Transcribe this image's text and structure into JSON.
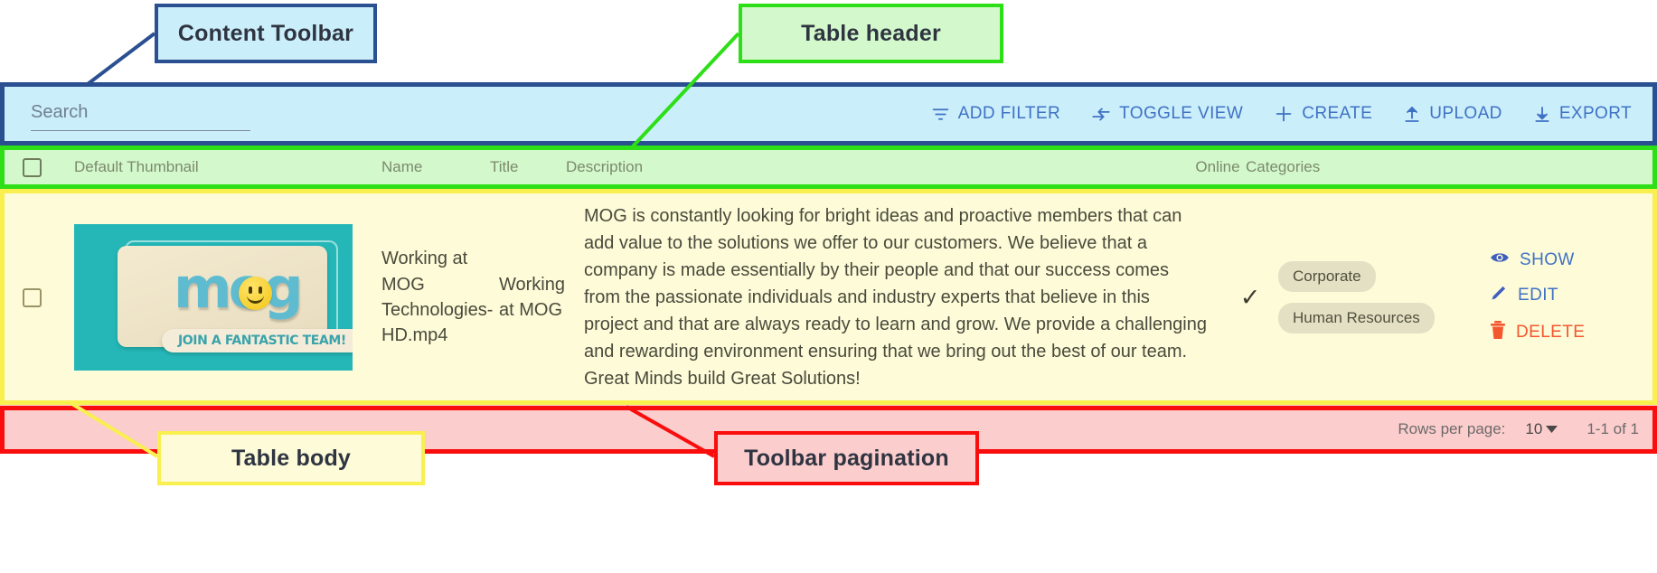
{
  "annotations": [
    {
      "id": "content-toolbar",
      "label": "Content Toolbar",
      "color": "#2b5091",
      "fill": "#cbeefb"
    },
    {
      "id": "table-header",
      "label": "Table header",
      "color": "#2ddf16",
      "fill": "#d3f8cc"
    },
    {
      "id": "table-body",
      "label": "Table body",
      "color": "#f9ef4f",
      "fill": "#fdfbd8"
    },
    {
      "id": "toolbar-pagination",
      "label": "Toolbar pagination",
      "color": "#f90d0d",
      "fill": "#fbcdcd"
    }
  ],
  "toolbar": {
    "search": {
      "value": "",
      "placeholder": "Search"
    },
    "actions": [
      {
        "label": "ADD FILTER",
        "icon": "filter-icon"
      },
      {
        "label": "TOGGLE VIEW",
        "icon": "toggle-view-icon"
      },
      {
        "label": "CREATE",
        "icon": "plus-icon"
      },
      {
        "label": "UPLOAD",
        "icon": "upload-icon"
      },
      {
        "label": "EXPORT",
        "icon": "download-icon"
      }
    ]
  },
  "table": {
    "columns": [
      {
        "key": "thumbnail",
        "label": "Default Thumbnail"
      },
      {
        "key": "name",
        "label": "Name"
      },
      {
        "key": "title",
        "label": "Title"
      },
      {
        "key": "description",
        "label": "Description"
      },
      {
        "key": "online",
        "label": "Online"
      },
      {
        "key": "categories",
        "label": "Categories"
      }
    ],
    "rows": [
      {
        "selected": false,
        "thumbnail": {
          "logo_text": "mog",
          "ribbon_text": "JOIN A FANTASTIC TEAM!",
          "background_color": "#25b7b7"
        },
        "name": "Working at MOG Technologies-HD.mp4",
        "title": "Working at MOG",
        "description": "MOG is constantly looking for bright ideas and proactive members that can add value to the solutions we offer to our customers. We believe that a company is made essentially by their people and that our success comes from the passionate individuals and industry experts that believe in this project and that are always ready to learn and grow. We provide a challenging and rewarding environment ensuring that we bring out the best of our team. Great Minds build Great Solutions!",
        "online": "✓",
        "categories": [
          "Corporate",
          "Human Resources"
        ],
        "actions": [
          {
            "label": "SHOW",
            "icon": "eye-icon",
            "color": "#3f72c4"
          },
          {
            "label": "EDIT",
            "icon": "pencil-icon",
            "color": "#3f72c4"
          },
          {
            "label": "DELETE",
            "icon": "trash-icon",
            "color": "#f4562f"
          }
        ]
      }
    ]
  },
  "pagination": {
    "rows_per_page_label": "Rows per page:",
    "rows_per_page_value": "10",
    "range_label": "1-1 of 1"
  }
}
